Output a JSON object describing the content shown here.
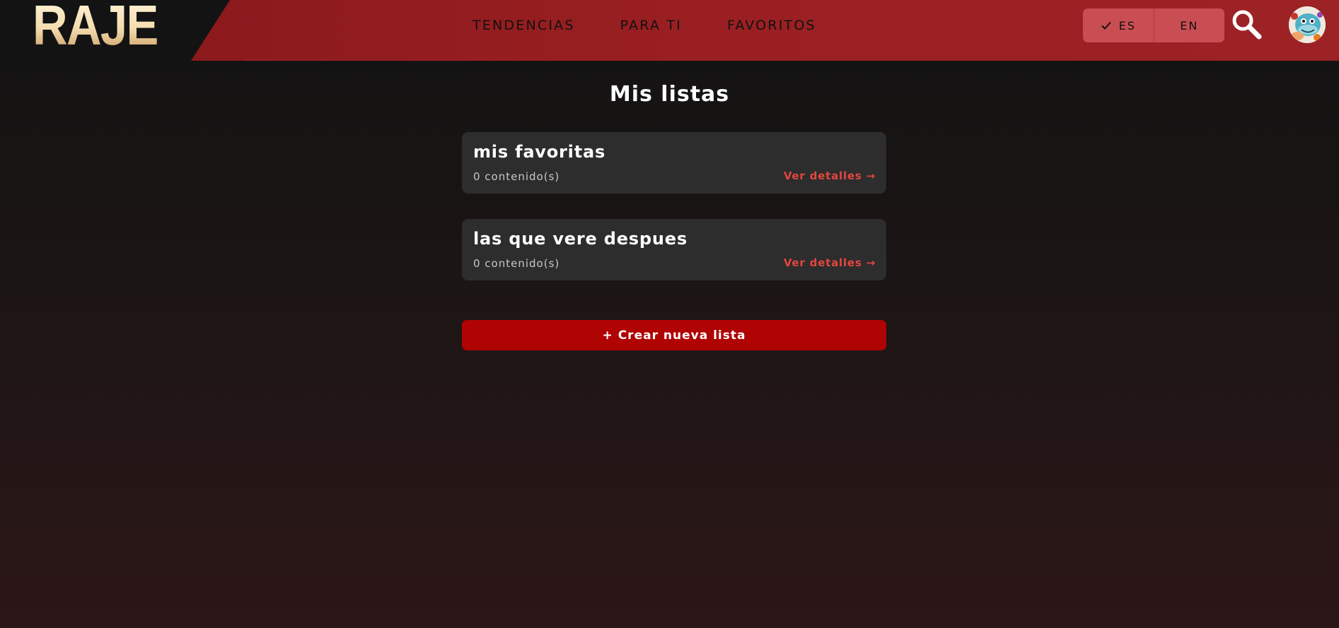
{
  "brand": {
    "logo_text": "RAJE"
  },
  "nav": {
    "items": [
      {
        "label": "TENDENCIAS"
      },
      {
        "label": "PARA TI"
      },
      {
        "label": "FAVORITOS"
      }
    ]
  },
  "language": {
    "options": [
      {
        "label": "ES",
        "selected": true
      },
      {
        "label": "EN",
        "selected": false
      }
    ]
  },
  "icons": {
    "search": "search-icon",
    "check": "check-icon",
    "avatar": "avatar"
  },
  "page": {
    "title": "Mis listas"
  },
  "lists": [
    {
      "name": "mis favoritas",
      "count": "0 contenido(s)",
      "link": "Ver detalles →"
    },
    {
      "name": "las que vere despues",
      "count": "0 contenido(s)",
      "link": "Ver detalles →"
    }
  ],
  "actions": {
    "create_label": "+ Crear nueva lista"
  },
  "colors": {
    "header_red": "#9a1f22",
    "accent_red": "#e2463f",
    "button_red": "#b00303",
    "card_bg": "#2d2d2d",
    "lang_bg": "#c94e54"
  }
}
